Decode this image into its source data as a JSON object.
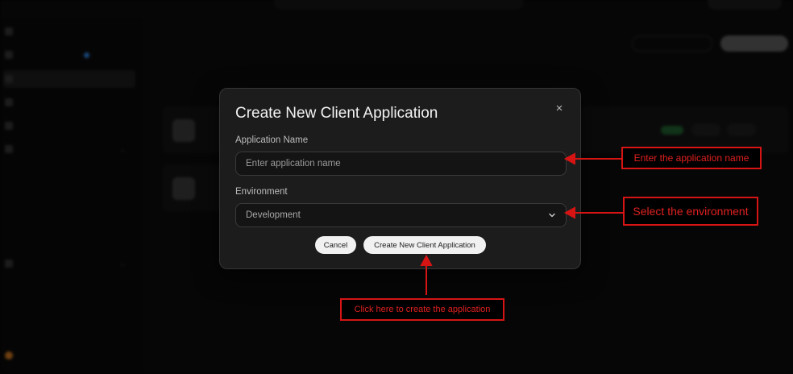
{
  "modal": {
    "title": "Create New Client Application",
    "app_name_label": "Application Name",
    "app_name_placeholder": "Enter application name",
    "app_name_value": "",
    "environment_label": "Environment",
    "environment_selected": "Development",
    "cancel_label": "Cancel",
    "create_label": "Create New Client Application",
    "close_glyph": "×"
  },
  "annotations": {
    "name_hint": "Enter the application name",
    "environment_hint": "Select the environment",
    "create_hint": "Click here to create the application"
  },
  "icons": {
    "close": "close-icon",
    "dropdown": "chevron-down-icon"
  },
  "colors": {
    "annotation_red": "#d61414",
    "modal_bg": "#1c1c1c",
    "button_bg": "#f1f1f1"
  }
}
